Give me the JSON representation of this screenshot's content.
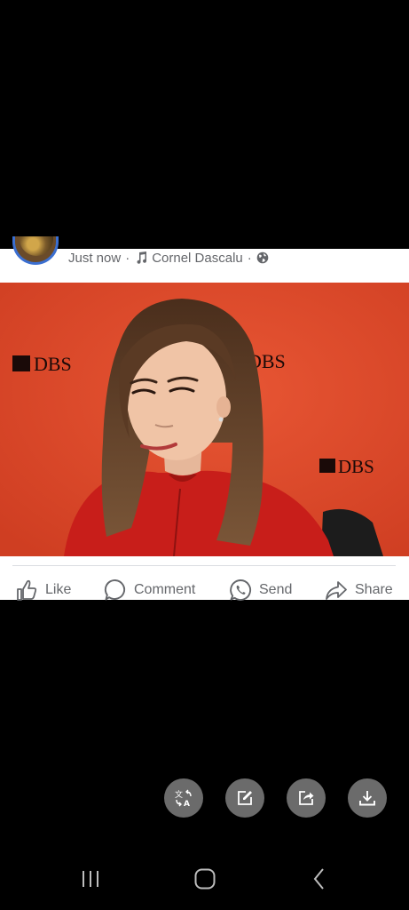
{
  "post": {
    "timestamp": "Just now",
    "separator": "·",
    "music_artist": "Cornel Dascalu",
    "icons": {
      "music": "music-note-icon",
      "audience": "globe-icon"
    },
    "photo": {
      "background_color": "#de4a2c",
      "backdrop_logos": [
        "DBS",
        "DBS",
        "DBS"
      ]
    }
  },
  "actions": {
    "like": "Like",
    "comment": "Comment",
    "send": "Send",
    "share": "Share"
  },
  "viewer_toolbar": {
    "buttons": [
      "translate-icon",
      "edit-icon",
      "share-icon",
      "download-icon"
    ]
  },
  "system_nav": {
    "buttons": [
      "recents-icon",
      "home-icon",
      "back-icon"
    ]
  }
}
